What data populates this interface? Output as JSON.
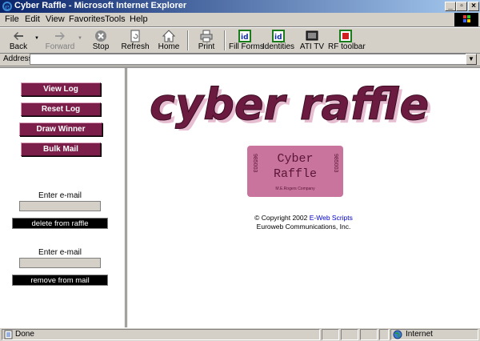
{
  "window": {
    "title": "Cyber Raffle - Microsoft Internet Explorer"
  },
  "menu": [
    "File",
    "Edit",
    "View",
    "Favorites",
    "Tools",
    "Help"
  ],
  "toolbar": {
    "back": "Back",
    "forward": "Forward",
    "stop": "Stop",
    "refresh": "Refresh",
    "home": "Home",
    "print": "Print",
    "fill_forms": "Fill Forms",
    "identities": "Identities",
    "ati_tv": "ATI TV",
    "rf_toolbar": "RF toolbar"
  },
  "address": {
    "label": "Address",
    "value": ""
  },
  "left": {
    "view_log": "View Log",
    "reset_log": "Reset Log",
    "draw_winner": "Draw Winner",
    "bulk_mail": "Bulk Mail",
    "enter_email_1": "Enter e-mail",
    "email_1": "",
    "delete_btn": "delete from raffle",
    "enter_email_2": "Enter e-mail",
    "email_2": "",
    "remove_btn": "remove from mail"
  },
  "main": {
    "logo_text": "cyber raffle",
    "ticket_line1": "Cyber",
    "ticket_line2": "Raffle",
    "ticket_number": "985003",
    "ticket_sub": "M.E.Rogers Company",
    "copyright_prefix": "© Copyright 2002 ",
    "copyright_link": "E-Web Scripts",
    "company": "Euroweb Communications, Inc."
  },
  "status": {
    "text": "Done",
    "zone": "Internet"
  },
  "colors": {
    "accent": "#7b1f4a",
    "ticket": "#c9749d"
  }
}
